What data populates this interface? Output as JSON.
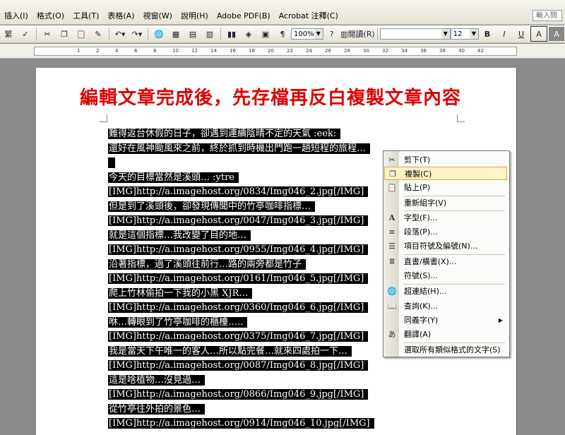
{
  "menu": [
    "插入(I)",
    "格式(O)",
    "工具(T)",
    "表格(A)",
    "視窗(W)",
    "說明(H)",
    "Adobe PDF(B)",
    "Acrobat 注釋(C)"
  ],
  "help_box": "輸入問",
  "toolbar": {
    "left_label": "繁",
    "zoom": "100%",
    "reading": "閱讀(R)",
    "font_size": "12",
    "bold": "B",
    "italic": "I",
    "underline": "U",
    "grow": "A",
    "big_a": "A"
  },
  "ruler": [
    "1",
    "2",
    "4",
    "6",
    "8",
    "10",
    "12",
    "14",
    "16",
    "18",
    "20",
    "22",
    "24",
    "26",
    "28",
    "30",
    "32",
    "34",
    "36",
    "38",
    "40",
    "42"
  ],
  "document": {
    "title": "編輯文章完成後，先存檔再反白複製文章內容",
    "lines": [
      "難得返台休假的日子，卻遇到連續陰晴不定的天氣 :eek:",
      "還好在風神颱風來之前，終於抓到時機出門跑一趟短程的旅程…",
      "",
      "今天的目標當然是溪頭… :ytre",
      "[IMG]http://a.imagehost.org/0834/Img046_2.jpg[/IMG]",
      "但是到了溪頭後，卻發現傳聞中的竹亭咖啡指標…",
      "[IMG]http://a.imagehost.org/0047/Img046_3.jpg[/IMG]",
      "就是這個指標…我改變了目的地…",
      "[IMG]http://a.imagehost.org/0955/Img046_4.jpg[/IMG]",
      "沿著指標，過了溪頭往前行…路的兩旁都是竹子",
      "[IMG]http://a.imagehost.org/0161/Img046_5.jpg[/IMG]",
      "爬上竹林偷拍一下我的小黑 XJR…",
      "[IMG]http://a.imagehost.org/0360/Img046_6.jpg[/IMG]",
      "咻…轉眼到了竹亭咖啡的櫃檯…..",
      "[IMG]http://a.imagehost.org/0375/Img046_7.jpg[/IMG]",
      "我是當天下午唯一的客人…所以點完餐…就來四處拍一下…",
      "[IMG]http://a.imagehost.org/0087/Img046_8.jpg[/IMG]",
      "這是啥植物…沒見過…",
      "[IMG]http://a.imagehost.org/0866/Img046_9.jpg[/IMG]",
      "從竹亭往外拍的景色…",
      "[IMG]http://a.imagehost.org/0914/Img046_10.jpg[/IMG]"
    ]
  },
  "context_menu": {
    "items": [
      {
        "label": "剪下(T)",
        "icon": "scissors-icon"
      },
      {
        "label": "複製(C)",
        "icon": "copy-icon"
      },
      {
        "label": "貼上(P)",
        "icon": "paste-icon"
      },
      {
        "label": "重新組字(V)",
        "icon": ""
      },
      {
        "label": "字型(F)...",
        "icon": "font-icon"
      },
      {
        "label": "段落(P)...",
        "icon": "paragraph-icon"
      },
      {
        "label": "項目符號及編號(N)...",
        "icon": "bullets-icon"
      },
      {
        "label": "直書/橫書(X)...",
        "icon": "text-direction-icon"
      },
      {
        "label": "符號(S)...",
        "icon": ""
      },
      {
        "label": "超連結(H)...",
        "icon": "hyperlink-icon"
      },
      {
        "label": "查詢(K)...",
        "icon": "lookup-icon"
      },
      {
        "label": "同義字(Y)",
        "icon": ""
      },
      {
        "label": "翻譯(A)",
        "icon": "translate-icon"
      },
      {
        "label": "選取所有類似格式的文字(S)",
        "icon": ""
      }
    ]
  }
}
